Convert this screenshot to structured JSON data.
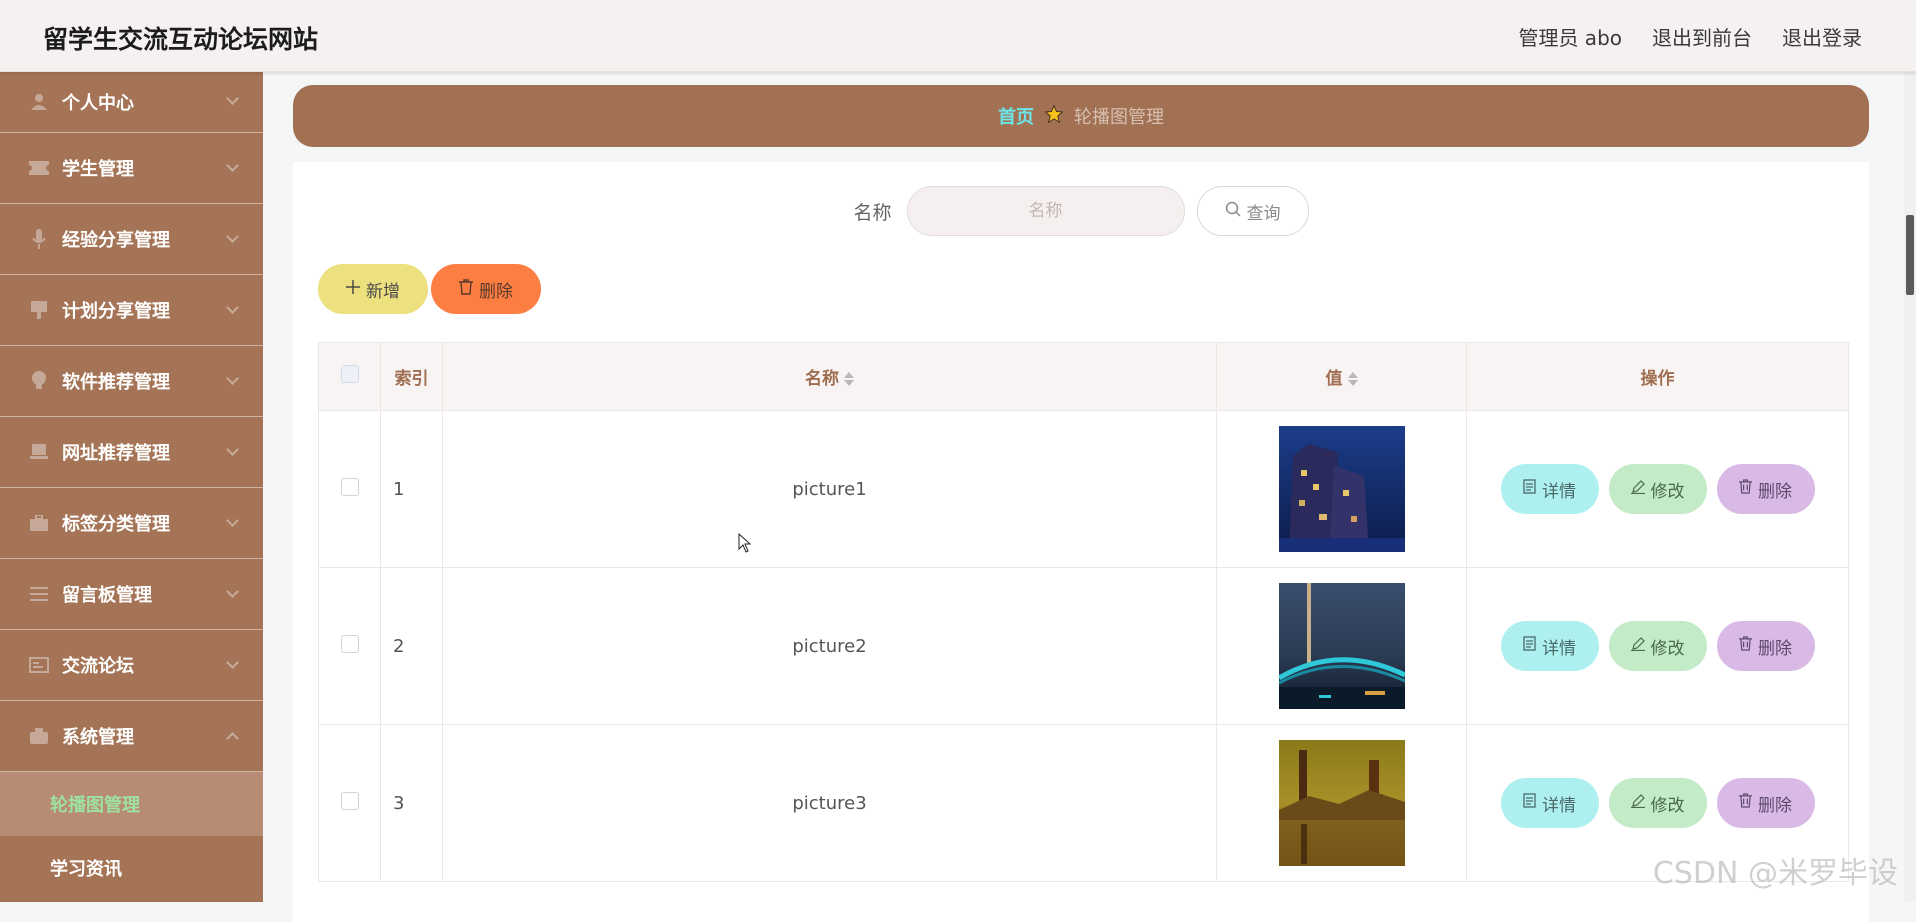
{
  "header": {
    "title": "留学生交流互动论坛网站",
    "links": [
      "管理员 abo",
      "退出到前台",
      "退出登录"
    ]
  },
  "sidebar": {
    "items": [
      {
        "label": "个人中心",
        "icon": "user-icon"
      },
      {
        "label": "学生管理",
        "icon": "ticket-icon"
      },
      {
        "label": "经验分享管理",
        "icon": "microphone-icon"
      },
      {
        "label": "计划分享管理",
        "icon": "monitor-icon"
      },
      {
        "label": "软件推荐管理",
        "icon": "lightbulb-icon"
      },
      {
        "label": "网址推荐管理",
        "icon": "laptop-icon"
      },
      {
        "label": "标签分类管理",
        "icon": "briefcase-icon"
      },
      {
        "label": "留言板管理",
        "icon": "list-icon"
      },
      {
        "label": "交流论坛",
        "icon": "card-icon"
      },
      {
        "label": "系统管理",
        "icon": "wallet-icon",
        "expanded": true
      }
    ],
    "sub_items": [
      {
        "label": "轮播图管理",
        "active": true
      },
      {
        "label": "学习资讯",
        "active": false
      }
    ]
  },
  "breadcrumb": {
    "home": "首页",
    "current": "轮播图管理"
  },
  "search": {
    "label": "名称",
    "placeholder": "名称",
    "button": "查询"
  },
  "actions": {
    "add": "新增",
    "delete": "删除"
  },
  "table": {
    "headers": {
      "index": "索引",
      "name": "名称",
      "value": "值",
      "ops": "操作"
    },
    "rows": [
      {
        "index": "1",
        "name": "picture1",
        "image": "night city building"
      },
      {
        "index": "2",
        "name": "picture2",
        "image": "lit bridge at dusk"
      },
      {
        "index": "3",
        "name": "picture3",
        "image": "golden river reflection"
      }
    ],
    "op_labels": {
      "detail": "详情",
      "edit": "修改",
      "delete": "删除"
    }
  },
  "watermark": "CSDN @米罗毕设",
  "colors": {
    "sidebar": "#a57456",
    "breadcrumb": "#a27153",
    "active_sub": "#9ee29f",
    "home_link": "#6be6e8",
    "add_button": "#ece07f",
    "delete_button": "#fc7e43",
    "detail_button": "#aef0f0",
    "edit_button": "#c4ebc8",
    "row_delete_button": "#d9b9e6"
  }
}
